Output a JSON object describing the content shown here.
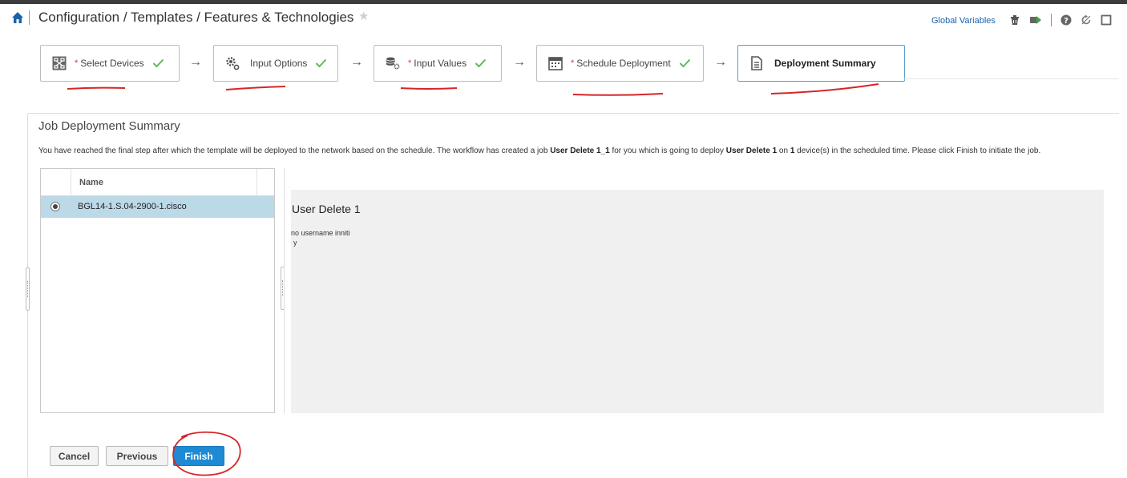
{
  "header": {
    "breadcrumb": "Configuration / Templates / Features & Technologies",
    "global_variables": "Global Variables"
  },
  "wizard": {
    "steps": [
      {
        "label": "Select Devices",
        "required": "*",
        "icon": "devices-icon",
        "completed": true
      },
      {
        "label": "Input Options",
        "required": "",
        "icon": "gears-icon",
        "completed": true
      },
      {
        "label": "Input Values",
        "required": "*",
        "icon": "database-gear-icon",
        "completed": true
      },
      {
        "label": "Schedule Deployment",
        "required": "*",
        "icon": "calendar-icon",
        "completed": true
      },
      {
        "label": "Deployment Summary",
        "required": "",
        "icon": "document-icon",
        "completed": false,
        "active": true
      }
    ]
  },
  "summary": {
    "title": "Job Deployment Summary",
    "desc_1": "You have reached the final step after which the template will be deployed to the network based on the schedule. The workflow has created a job ",
    "job_name": "User Delete 1_1",
    "desc_2": " for you which is going to deploy ",
    "template_name": "User Delete 1",
    "desc_3": " on ",
    "device_count": "1",
    "desc_4": " device(s) in the scheduled time. Please click Finish to initiate the job."
  },
  "device_list": {
    "column_name": "Name",
    "rows": [
      {
        "name": "BGL14-1.S.04-2900-1.cisco",
        "selected": true
      }
    ]
  },
  "preview": {
    "title": "User Delete 1",
    "line1": "no username inniti",
    "line2": "y"
  },
  "buttons": {
    "cancel": "Cancel",
    "previous": "Previous",
    "finish": "Finish"
  },
  "colors": {
    "accent": "#1d8ad3",
    "check": "#5cb85c",
    "required": "#d0343b",
    "annotation": "#d62626",
    "selected_row": "#bcd9e8"
  }
}
